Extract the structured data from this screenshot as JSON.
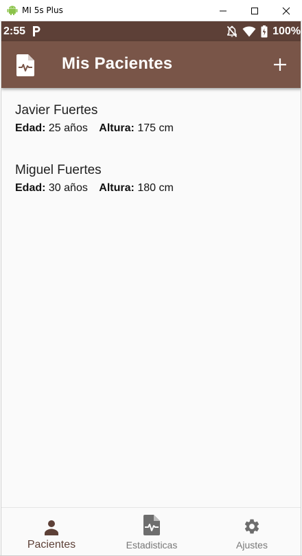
{
  "window": {
    "title": "MI 5s Plus",
    "icon": "android-icon",
    "controls": [
      "minimize-icon",
      "maximize-icon",
      "close-icon"
    ]
  },
  "status_bar": {
    "time": "2:55",
    "notification_icon": "parking-p-icon",
    "icons": [
      "notifications-off-icon",
      "wifi-icon",
      "battery-icon"
    ],
    "battery": "100%"
  },
  "app_bar": {
    "icon": "medical-document-icon",
    "title": "Mis Pacientes",
    "action_icon": "add-icon"
  },
  "patients": [
    {
      "name": "Javier Fuertes",
      "age_label": "Edad:",
      "age_value": "25 años",
      "height_label": "Altura:",
      "height_value": "175 cm"
    },
    {
      "name": "Miguel Fuertes",
      "age_label": "Edad:",
      "age_value": "30 años",
      "height_label": "Altura:",
      "height_value": "180 cm"
    }
  ],
  "bottom_nav": [
    {
      "label": "Pacientes",
      "icon": "person-icon",
      "active": true
    },
    {
      "label": "Estadisticas",
      "icon": "stats-document-icon",
      "active": false
    },
    {
      "label": "Ajustes",
      "icon": "gear-icon",
      "active": false
    }
  ],
  "colors": {
    "status_bar": "#5d4037",
    "app_bar": "#795548",
    "active_nav": "#5d4037",
    "inactive_nav": "#777777",
    "background": "#fafafa"
  }
}
